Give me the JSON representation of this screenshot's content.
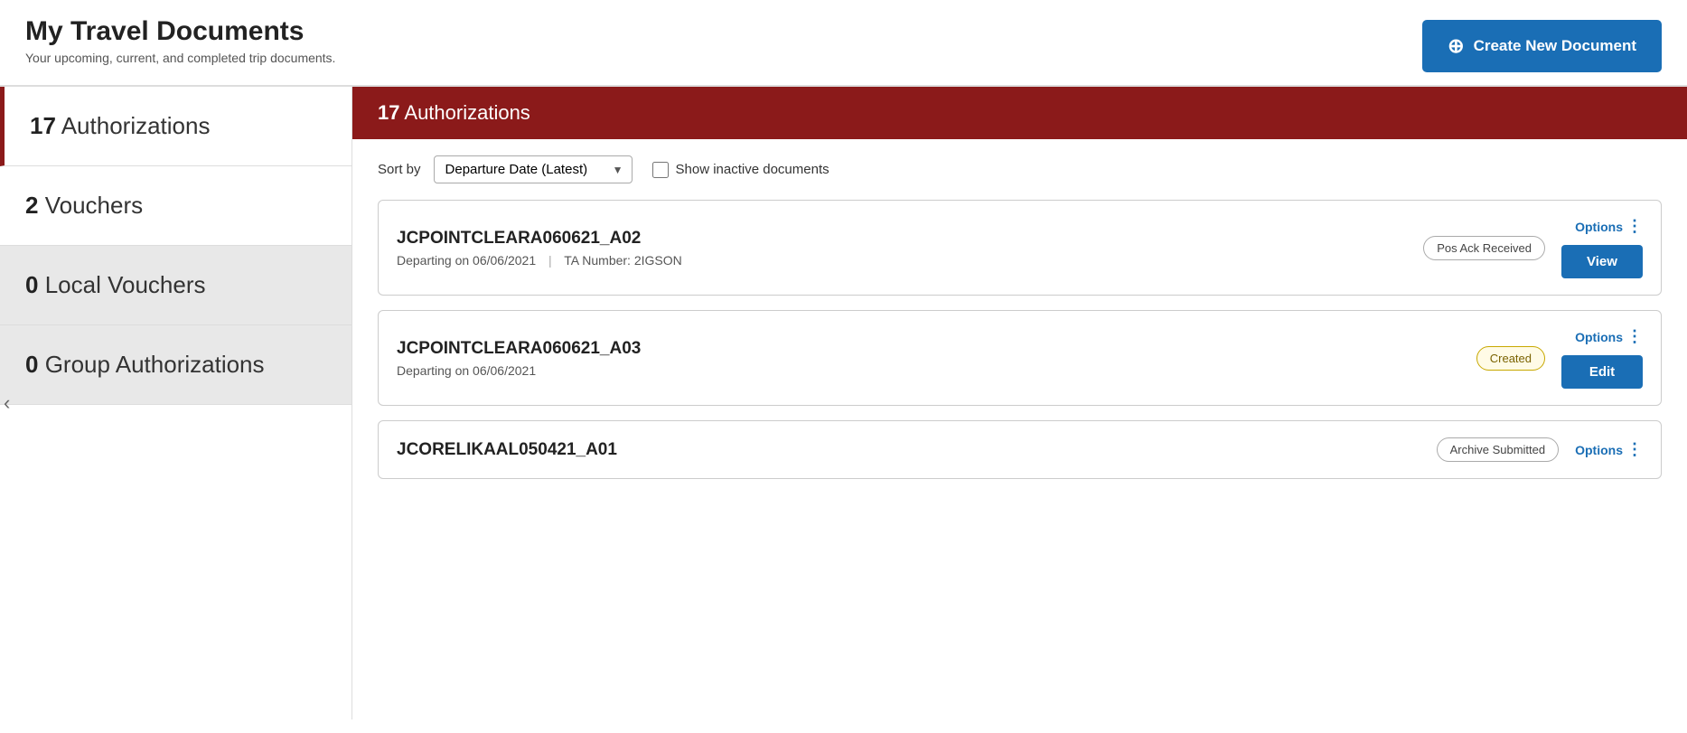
{
  "header": {
    "title": "My Travel Documents",
    "subtitle": "Your upcoming, current, and completed trip documents.",
    "create_button_label": "Create New Document"
  },
  "sidebar": {
    "nav_arrow": "‹",
    "items": [
      {
        "id": "authorizations",
        "count": "17",
        "label": "Authorizations",
        "active": true,
        "inactive_bg": false
      },
      {
        "id": "vouchers",
        "count": "2",
        "label": "Vouchers",
        "active": false,
        "inactive_bg": false
      },
      {
        "id": "local-vouchers",
        "count": "0",
        "label": "Local Vouchers",
        "active": false,
        "inactive_bg": true
      },
      {
        "id": "group-authorizations",
        "count": "0",
        "label": "Group Authorizations",
        "active": false,
        "inactive_bg": true
      }
    ]
  },
  "content": {
    "section_header_count": "17",
    "section_header_label": "Authorizations",
    "sort_label": "Sort by",
    "sort_option": "Departure Date (Latest)",
    "show_inactive_label": "Show inactive documents",
    "documents": [
      {
        "id": "doc1",
        "name": "JCPOINTCLEARA060621_A02",
        "departing": "Departing on 06/06/2021",
        "ta_number": "TA Number: 2IGSON",
        "has_ta": true,
        "status": "Pos Ack Received",
        "status_type": "pos-ack",
        "action_label": "View"
      },
      {
        "id": "doc2",
        "name": "JCPOINTCLEARA060621_A03",
        "departing": "Departing on 06/06/2021",
        "ta_number": "",
        "has_ta": false,
        "status": "Created",
        "status_type": "created",
        "action_label": "Edit"
      },
      {
        "id": "doc3",
        "name": "JCORELIKAAL050421_A01",
        "departing": "",
        "ta_number": "",
        "has_ta": false,
        "status": "Archive Submitted",
        "status_type": "archive-submitted",
        "action_label": "Options"
      }
    ]
  }
}
